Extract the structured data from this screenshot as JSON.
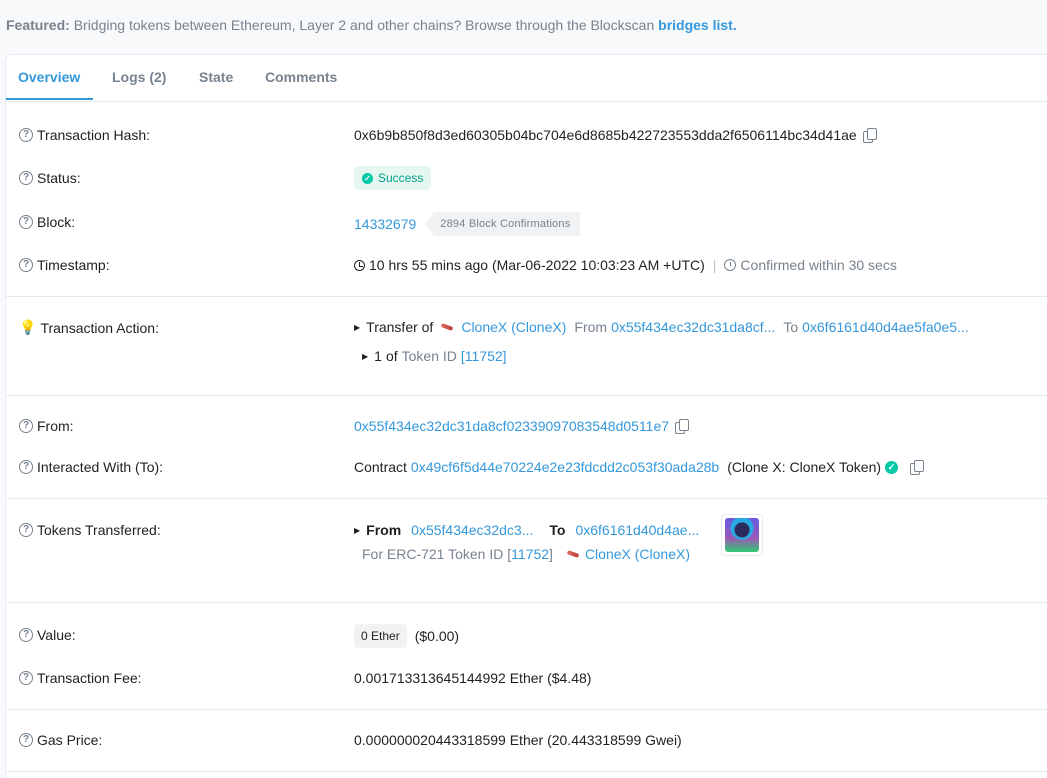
{
  "featured": {
    "prefix": "Featured:",
    "text": "Bridging tokens between Ethereum, Layer 2 and other chains? Browse through the Blockscan",
    "link": "bridges list."
  },
  "tabs": [
    "Overview",
    "Logs (2)",
    "State",
    "Comments"
  ],
  "tx_hash": {
    "label": "Transaction Hash:",
    "value": "0x6b9b850f8d3ed60305b04bc704e6d8685b422723553dda2f6506114bc34d41ae"
  },
  "status": {
    "label": "Status:",
    "value": "Success"
  },
  "block": {
    "label": "Block:",
    "number": "14332679",
    "confirmations": "2894 Block Confirmations"
  },
  "timestamp": {
    "label": "Timestamp:",
    "value": "10 hrs 55 mins ago (Mar-06-2022 10:03:23 AM +UTC)",
    "sep": "|",
    "confirmed": "Confirmed within 30 secs"
  },
  "tx_action": {
    "label": "Transaction Action:",
    "transfer_of": "Transfer of",
    "token": "CloneX (CloneX)",
    "from_label": "From",
    "from": "0x55f434ec32dc31da8cf...",
    "to_label": "To",
    "to": "0x6f6161d40d4ae5fa0e5...",
    "qty": "1",
    "of": "of",
    "token_id_label": "Token ID",
    "token_id": "[11752]"
  },
  "from": {
    "label": "From:",
    "value": "0x55f434ec32dc31da8cf02339097083548d0511e7"
  },
  "interacted": {
    "label": "Interacted With (To):",
    "prefix": "Contract",
    "address": "0x49cf6f5d44e70224e2e23fdcdd2c053f30ada28b",
    "name": "(Clone X: CloneX Token)"
  },
  "tokens": {
    "label": "Tokens Transferred:",
    "from_label": "From",
    "from": "0x55f434ec32dc3...",
    "to_label": "To",
    "to": "0x6f6161d40d4ae...",
    "for_text": "For ERC-721 Token ID [",
    "token_id": "11752",
    "close": "]",
    "token": "CloneX (CloneX)"
  },
  "value": {
    "label": "Value:",
    "ether": "0 Ether",
    "usd": "($0.00)"
  },
  "fee": {
    "label": "Transaction Fee:",
    "value": "0.001713313645144992 Ether ($4.48)"
  },
  "gas": {
    "label": "Gas Price:",
    "value": "0.000000020443318599 Ether (20.443318599 Gwei)"
  },
  "colors": {
    "accent": "#3498db",
    "success": "#00c9a7",
    "muted": "#77838f"
  }
}
